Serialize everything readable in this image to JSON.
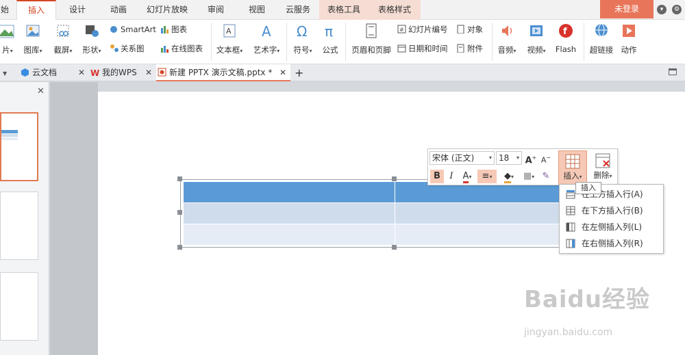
{
  "menubar": {
    "tabs": [
      {
        "label": "始"
      },
      {
        "label": "插入"
      },
      {
        "label": "设计"
      },
      {
        "label": "动画"
      },
      {
        "label": "幻灯片放映"
      },
      {
        "label": "审阅"
      },
      {
        "label": "视图"
      },
      {
        "label": "云服务"
      },
      {
        "label": "表格工具"
      },
      {
        "label": "表格样式"
      }
    ],
    "login": "未登录"
  },
  "ribbon": {
    "picture": "片",
    "gallery": "图库",
    "screenshot": "截屏",
    "shape": "形状",
    "smartart": "SmartArt",
    "relation": "关系图",
    "chart": "图表",
    "online_chart": "在线图表",
    "textbox": "文本框",
    "wordart": "艺术字",
    "symbol": "符号",
    "formula": "公式",
    "header_footer": "页眉和页脚",
    "slide_number": "幻灯片编号",
    "datetime": "日期和时间",
    "object": "对象",
    "attachment": "附件",
    "audio": "音频",
    "video": "视频",
    "flash": "Flash",
    "hyperlink": "超链接",
    "action": "动作"
  },
  "doctabs": [
    {
      "label": "云文档"
    },
    {
      "label": "我的WPS"
    },
    {
      "label": "新建 PPTX 演示文稿.pptx *"
    }
  ],
  "minibar": {
    "font": "宋体 (正文)",
    "size": "18",
    "insert": "插入",
    "delete": "删除"
  },
  "tooltip": "插入",
  "dropdown": {
    "items": [
      {
        "label": "在上方插入行(A)"
      },
      {
        "label": "在下方插入行(B)"
      },
      {
        "label": "在左侧插入列(L)"
      },
      {
        "label": "在右侧插入列(R)"
      }
    ]
  },
  "watermark": {
    "main": "Baidu经验",
    "sub": "jingyan.baidu.com"
  }
}
